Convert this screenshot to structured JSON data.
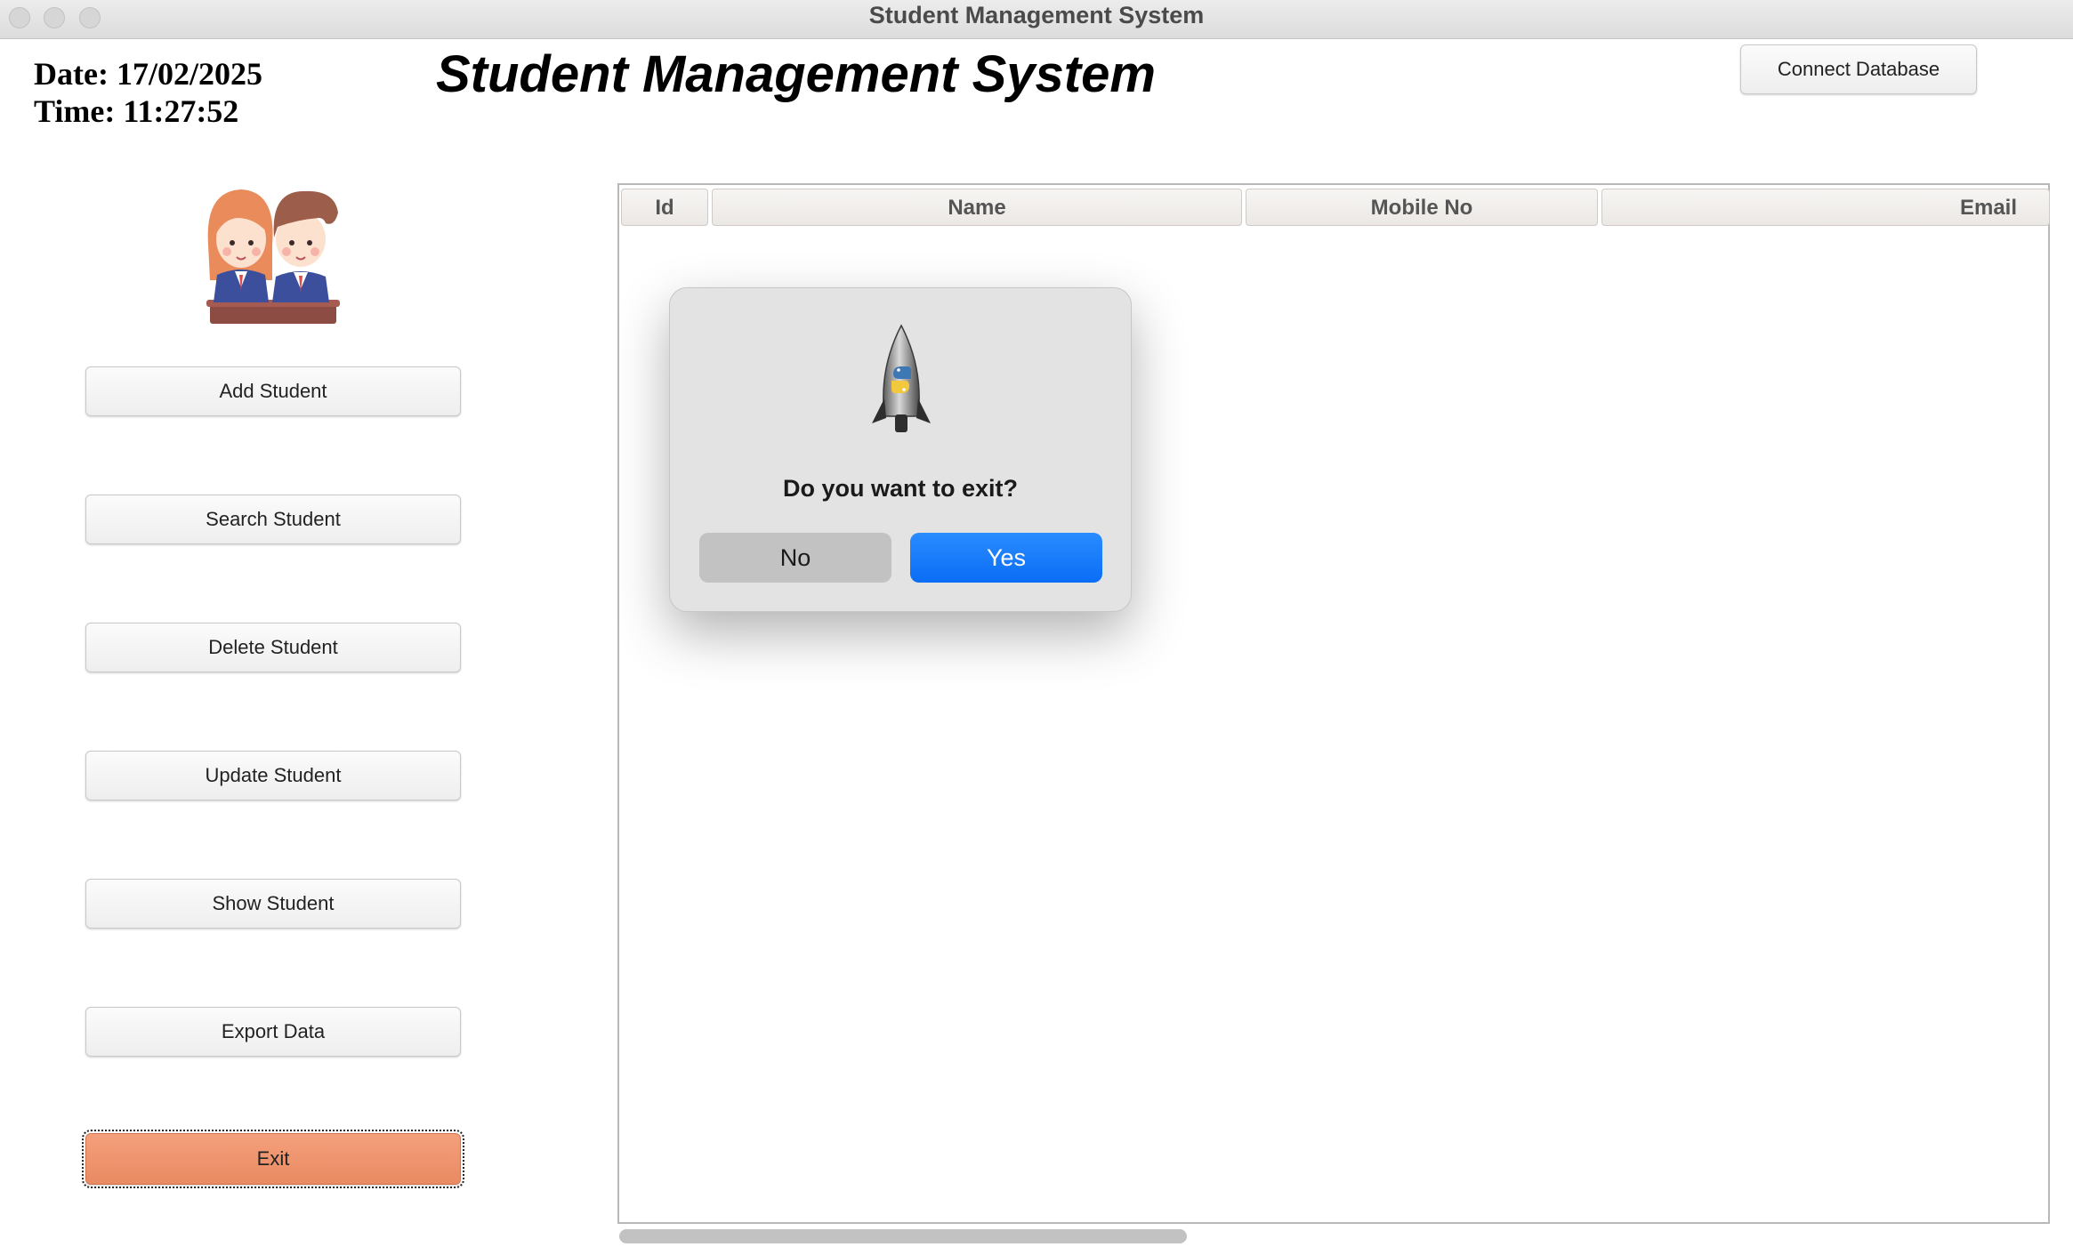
{
  "window": {
    "title": "Student Management System"
  },
  "header": {
    "date": "Date: 17/02/2025",
    "time": "Time: 11:27:52",
    "heading": "Student Management System",
    "connect_label": "Connect Database"
  },
  "sidebar": {
    "logo_icon": "students-icon",
    "buttons": [
      {
        "label": "Add Student"
      },
      {
        "label": "Search Student"
      },
      {
        "label": "Delete Student"
      },
      {
        "label": "Update Student"
      },
      {
        "label": "Show Student"
      },
      {
        "label": "Export Data"
      },
      {
        "label": "Exit"
      }
    ],
    "exit_color": "#ef916c"
  },
  "table": {
    "columns": [
      "Id",
      "Name",
      "Mobile No",
      "Email"
    ],
    "rows": []
  },
  "dialog": {
    "icon": "python-rocket-icon",
    "message": "Do you want to exit?",
    "no_label": "No",
    "yes_label": "Yes",
    "accent": "#0a6df5"
  }
}
